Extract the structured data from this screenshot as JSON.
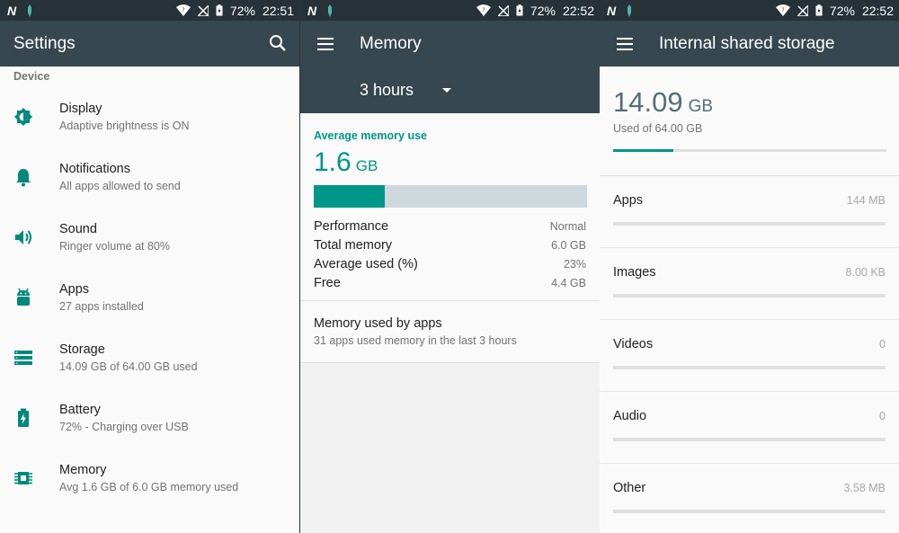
{
  "status_bars": [
    {
      "battery": "72%",
      "time": "22:51"
    },
    {
      "battery": "72%",
      "time": "22:52"
    },
    {
      "battery": "72%",
      "time": "22:52"
    }
  ],
  "settings": {
    "title": "Settings",
    "section": "Device",
    "items": [
      {
        "title": "Display",
        "subtitle": "Adaptive brightness is ON",
        "icon": "brightness-icon"
      },
      {
        "title": "Notifications",
        "subtitle": "All apps allowed to send",
        "icon": "bell-icon"
      },
      {
        "title": "Sound",
        "subtitle": "Ringer volume at 80%",
        "icon": "volume-icon"
      },
      {
        "title": "Apps",
        "subtitle": "27 apps installed",
        "icon": "android-icon"
      },
      {
        "title": "Storage",
        "subtitle": "14.09 GB of 64.00 GB used",
        "icon": "storage-icon"
      },
      {
        "title": "Battery",
        "subtitle": "72% - Charging over USB",
        "icon": "battery-charging-icon"
      },
      {
        "title": "Memory",
        "subtitle": "Avg 1.6 GB of 6.0 GB memory used",
        "icon": "memory-icon"
      }
    ]
  },
  "memory": {
    "title": "Memory",
    "period": "3 hours",
    "avg_label": "Average memory use",
    "avg_value": "1.6",
    "avg_unit": "GB",
    "usage_fraction": 0.26,
    "rows": [
      {
        "key": "Performance",
        "value": "Normal"
      },
      {
        "key": "Total memory",
        "value": "6.0 GB"
      },
      {
        "key": "Average used (%)",
        "value": "23%"
      },
      {
        "key": "Free",
        "value": "4.4 GB"
      }
    ],
    "apps_title": "Memory used by apps",
    "apps_subtitle": "31 apps used memory in the last 3 hours"
  },
  "storage": {
    "title": "Internal shared storage",
    "used_value": "14.09",
    "used_unit": "GB",
    "used_label": "Used of 64.00 GB",
    "used_fraction": 0.22,
    "categories": [
      {
        "name": "Apps",
        "size": "144 MB"
      },
      {
        "name": "Images",
        "size": "8.00 KB"
      },
      {
        "name": "Videos",
        "size": "0"
      },
      {
        "name": "Audio",
        "size": "0"
      },
      {
        "name": "Other",
        "size": "3.58 MB"
      }
    ]
  },
  "colors": {
    "accent": "#009688",
    "toolbar": "#37474f",
    "statusbar": "#263238"
  }
}
